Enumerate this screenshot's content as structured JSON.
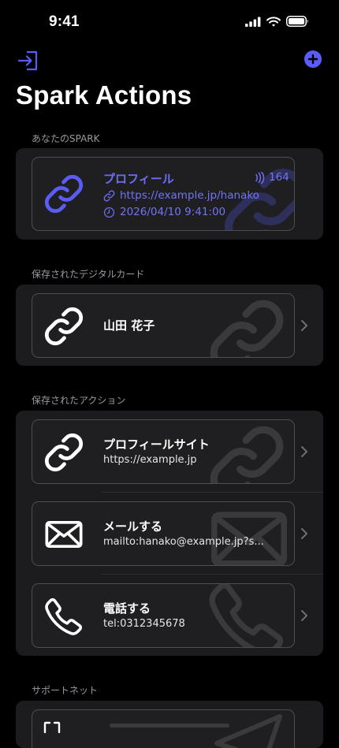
{
  "status": {
    "time": "9:41"
  },
  "nav": {
    "title": "Spark Actions",
    "exit_icon": "exit-icon",
    "add_icon": "plus-circle-icon"
  },
  "sections": {
    "your_spark": {
      "label": "あなたのSPARK",
      "card": {
        "title": "プロフィール",
        "url": "https://example.jp/hanako",
        "datetime": "2026/04/10 9:41:00",
        "count": "164",
        "icon": "link-icon"
      }
    },
    "saved_cards": {
      "label": "保存されたデジタルカード",
      "items": [
        {
          "title": "山田 花子",
          "icon": "link-icon"
        }
      ]
    },
    "saved_actions": {
      "label": "保存されたアクション",
      "items": [
        {
          "title": "プロフィールサイト",
          "subtitle": "https://example.jp",
          "icon": "link-icon"
        },
        {
          "title": "メールする",
          "subtitle": "mailto:hanako@example.jp?s...",
          "icon": "mail-icon"
        },
        {
          "title": "電話する",
          "subtitle": "tel:0312345678",
          "icon": "phone-icon"
        }
      ]
    },
    "support": {
      "label": "サポートネット"
    }
  },
  "colors": {
    "accent": "#5b5cf6",
    "background": "#000000",
    "group_bg": "#1c1c1e",
    "card_border": "#4d4d52",
    "section_label": "#9a9aa0"
  }
}
